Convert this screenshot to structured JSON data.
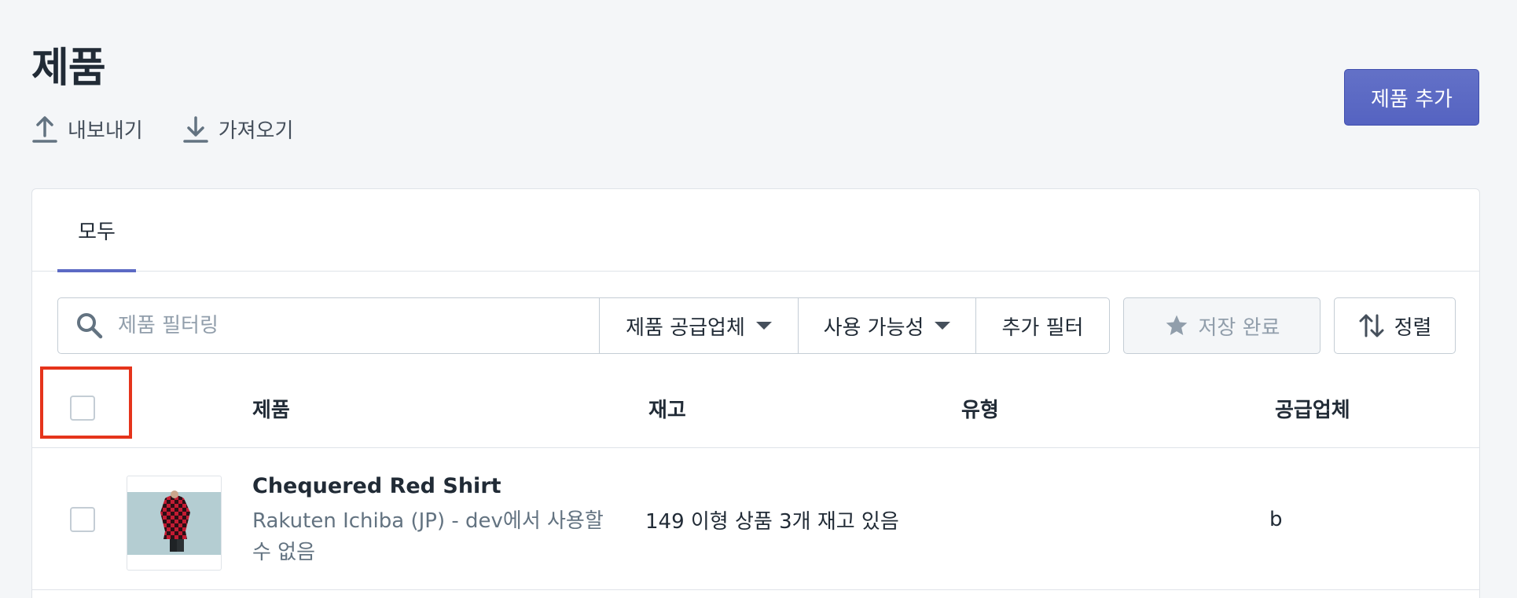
{
  "page": {
    "title": "제품"
  },
  "actions": {
    "export_label": "내보내기",
    "import_label": "가져오기"
  },
  "primary_button": {
    "label": "제품 추가"
  },
  "tabs": [
    {
      "label": "모두",
      "selected": true
    }
  ],
  "filters": {
    "search_placeholder": "제품 필터링",
    "vendor_label": "제품 공급업체",
    "availability_label": "사용 가능성",
    "more_label": "추가 필터",
    "saved_label": "저장 완료",
    "sort_label": "정렬"
  },
  "table": {
    "columns": [
      "제품",
      "재고",
      "유형",
      "공급업체"
    ],
    "rows": [
      {
        "name": "Chequered Red Shirt",
        "subtitle": "Rakuten Ichiba (JP) - dev에서 사용할 수 없음",
        "inventory": "149 이형 상품 3개 재고 있음",
        "type": "",
        "vendor": "b"
      }
    ]
  },
  "colors": {
    "accent": "#5c6ac4",
    "highlight": "#e5341b"
  }
}
